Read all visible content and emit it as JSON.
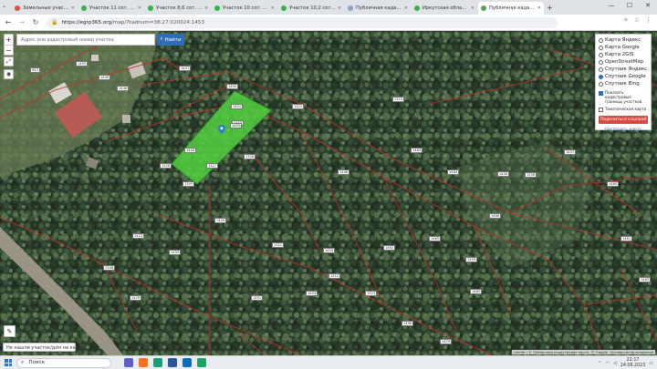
{
  "browser": {
    "tabs": [
      {
        "title": "Земельные участки в Иркутск",
        "color": "#e84d3b",
        "active": false
      },
      {
        "title": "Участок 11 сот. (ИЖС) в Иркутс",
        "color": "#33b24a",
        "active": false
      },
      {
        "title": "Участок 8,6 сот. (СНТ, ДНП)",
        "color": "#33b24a",
        "active": false
      },
      {
        "title": "Участок 10 сот. (СНТ, ДНП)",
        "color": "#33b24a",
        "active": false
      },
      {
        "title": "Участок 10,2 сот. (личное",
        "color": "#33b24a",
        "active": false
      },
      {
        "title": "Публичная кадастровая к",
        "color": "#8aa4c8",
        "active": false
      },
      {
        "title": "Иркутская область, Шелех",
        "color": "#33b24a",
        "active": false
      },
      {
        "title": "Публичная кадастровая к",
        "color": "#5aa05a",
        "active": true
      }
    ],
    "new_tab": "+",
    "window_controls": {
      "minimize": "—",
      "maximize": "☐",
      "close": "✕"
    },
    "back": "←",
    "forward": "→",
    "reload": "↻",
    "url_host": "https://egrp365.org",
    "url_path": "/map/?kadnum=38:27:020024:1453",
    "toolbar_icons": [
      "extension-icon",
      "star-icon",
      "menu-icon"
    ]
  },
  "map": {
    "search_placeholder": "Адрес или кадастровый номер участка",
    "find_button": "Найти",
    "zoom_in": "+",
    "zoom_out": "−",
    "layers": {
      "options": [
        {
          "label": "Карта Яндекс",
          "selected": false
        },
        {
          "label": "Карта Google",
          "selected": false
        },
        {
          "label": "Карта 2GIS",
          "selected": false
        },
        {
          "label": "OpenStreetMap",
          "selected": false
        },
        {
          "label": "Спутник Яндекс",
          "selected": false
        },
        {
          "label": "Спутник Google",
          "selected": true
        },
        {
          "label": "Спутник Bing",
          "selected": false
        }
      ],
      "show_borders_label": "Показать кадастровые границы участков",
      "show_borders_checked": true,
      "thematic_label": "Тематическая карта",
      "thematic_checked": false,
      "share_button": "Поделиться ссылкой",
      "setup_link": "Настроить карту"
    },
    "parcel_labels": [
      "953",
      "1455",
      "1449",
      "1401",
      "1446",
      "1450",
      "1451",
      "1402",
      "1453",
      "1454",
      "1322",
      "1323",
      "1463",
      "1464",
      "1440",
      "1458",
      "1457",
      "1460",
      "1461",
      "1462",
      "1466",
      "1459",
      "1465",
      "1462",
      "1448",
      "1321",
      "1429",
      "1325",
      "1326",
      "1327",
      "1328",
      "1454",
      "1412",
      "1403",
      "1323",
      "1438",
      "1429",
      "1423",
      "1452",
      "1465",
      "1346",
      "1429",
      "1451"
    ],
    "highlighted_parcel": "1453",
    "not_found_button": "Не нашли участок/дом на карте?",
    "attribution": "Leaflet | © Публичная кадастровая карта, © Google, Условия использования"
  },
  "taskbar": {
    "search_label": "Поиск",
    "time": "22:17",
    "date": "24.06.2023",
    "app_colors": [
      "#5b5fc7",
      "#f97316",
      "#1b9e77",
      "#2b579a",
      "#0f6cbd",
      "#1ea362"
    ]
  }
}
